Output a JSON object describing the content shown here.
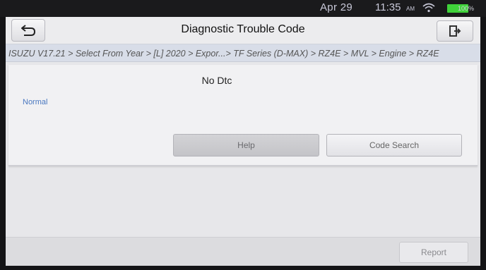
{
  "status_bar": {
    "date": "Apr 29",
    "time": "11:35",
    "ampm": "AM",
    "battery": "100%",
    "battery_color": "#3fd23a"
  },
  "header": {
    "title": "Diagnostic Trouble Code",
    "back_icon": "back-arrow-icon",
    "exit_icon": "exit-icon"
  },
  "breadcrumb": "ISUZU V17.21 > Select From Year > [L] 2020 > Expor...> TF Series (D-MAX) > RZ4E > MVL > Engine > RZ4E",
  "panel": {
    "message": "No Dtc",
    "status": "Normal",
    "status_color": "#4a78c0"
  },
  "buttons": {
    "help": "Help",
    "code_search": "Code Search",
    "report": "Report"
  }
}
